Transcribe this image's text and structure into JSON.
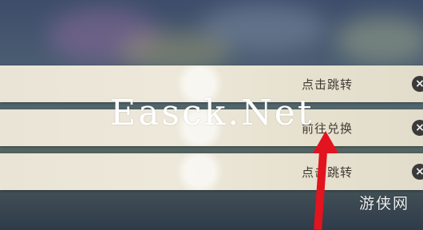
{
  "watermark": "Easck.Net",
  "rows": [
    {
      "label": "点击跳转",
      "close": "×"
    },
    {
      "label": "前往兑换",
      "close": "×"
    },
    {
      "label": "点击跳转",
      "close": "×"
    }
  ],
  "corner_logo": "游侠网",
  "colors": {
    "arrow": "#e2141f",
    "banner": "#ece7d9"
  }
}
